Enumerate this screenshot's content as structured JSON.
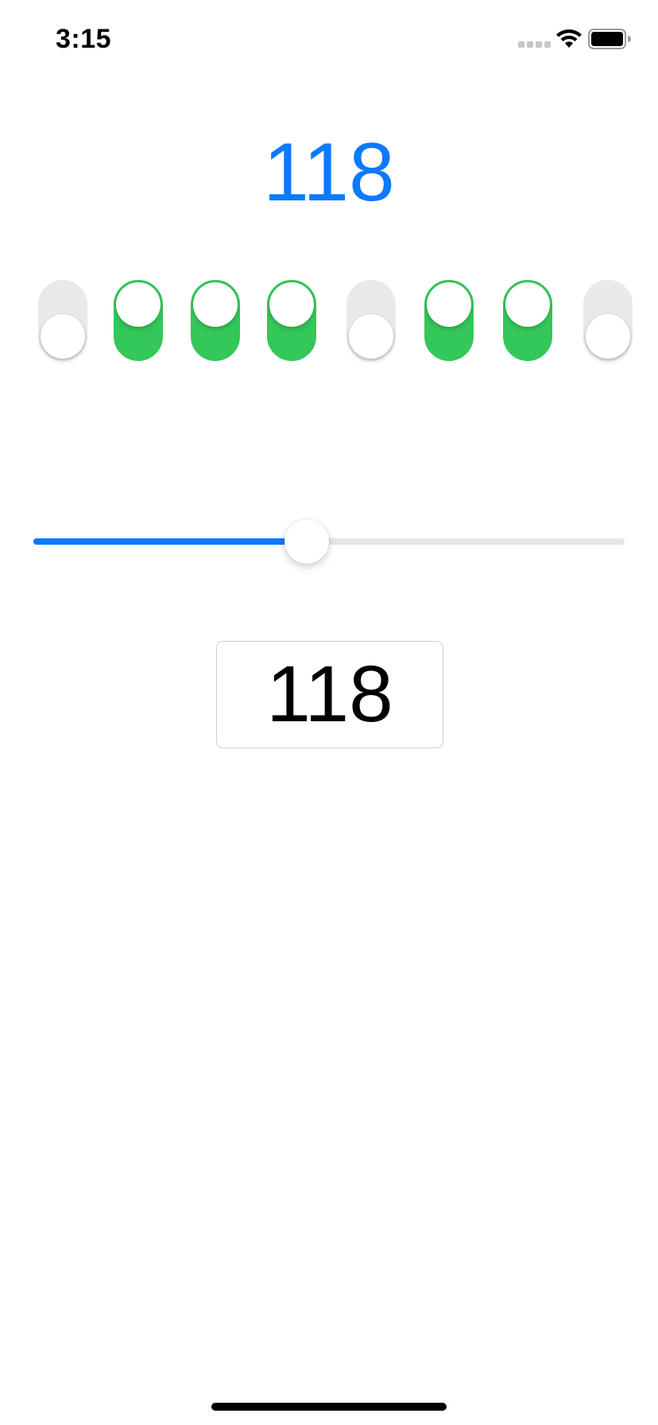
{
  "status_bar": {
    "time": "3:15",
    "icons": [
      "cellular-signal-icon",
      "wifi-icon",
      "battery-icon"
    ]
  },
  "display": {
    "value": "118",
    "color": "#0a7aff"
  },
  "switches": [
    {
      "index": 0,
      "on": false
    },
    {
      "index": 1,
      "on": true
    },
    {
      "index": 2,
      "on": true
    },
    {
      "index": 3,
      "on": true
    },
    {
      "index": 4,
      "on": false
    },
    {
      "index": 5,
      "on": true
    },
    {
      "index": 6,
      "on": true
    },
    {
      "index": 7,
      "on": false
    }
  ],
  "slider": {
    "value": 118,
    "min": 0,
    "max": 255,
    "fill_color": "#0a7aff"
  },
  "input": {
    "value": "118"
  },
  "colors": {
    "switch_on": "#34c759",
    "switch_off": "#e9e9eb"
  }
}
